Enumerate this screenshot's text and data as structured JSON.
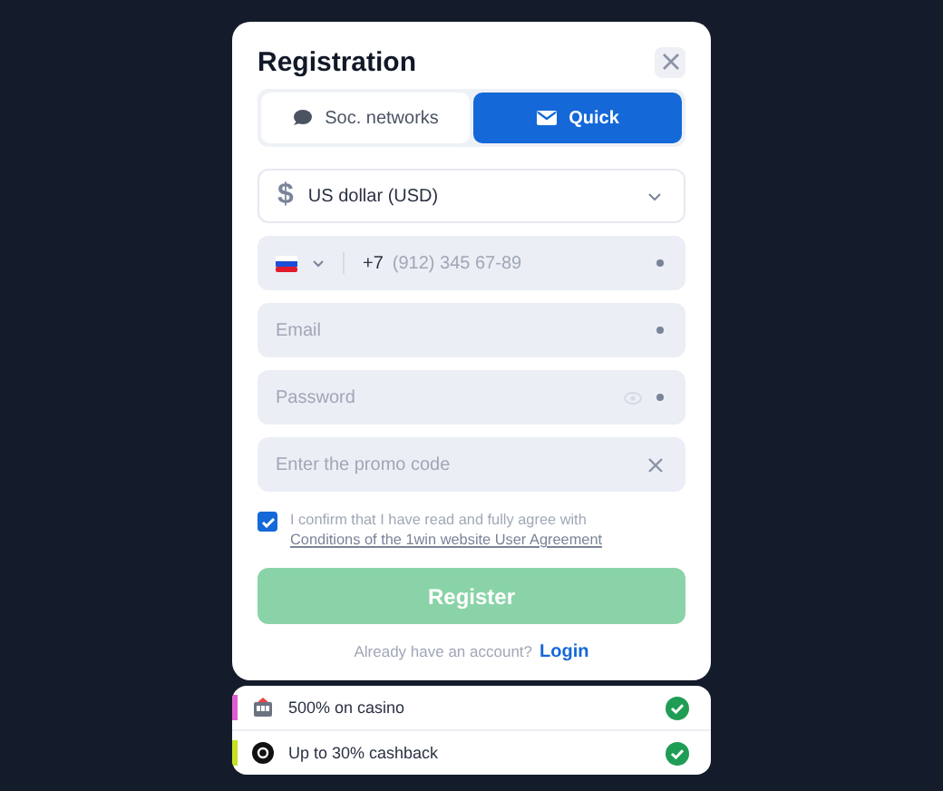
{
  "dialog": {
    "title": "Registration"
  },
  "tabs": [
    {
      "label": "Soc. networks",
      "selected": false
    },
    {
      "label": "Quick",
      "selected": true
    }
  ],
  "currency": {
    "symbol": "$",
    "value": "US dollar (USD)"
  },
  "phone": {
    "code": "+7",
    "placeholder": "(912) 345 67-89",
    "required": true
  },
  "email": {
    "placeholder": "Email",
    "required": true
  },
  "password": {
    "placeholder": "Password",
    "required": true
  },
  "promo": {
    "placeholder": "Enter the promo code"
  },
  "agreement": {
    "checked": true,
    "text": "I confirm that I have read and fully agree with",
    "link": "Conditions of the 1win website User Agreement"
  },
  "register": {
    "label": "Register",
    "disabled": true
  },
  "login_prompt": {
    "text": "Already have an account?",
    "link": "Login"
  },
  "bonuses": [
    {
      "kind": "casino",
      "text": "500% on casino",
      "color": "#e05cd0",
      "done": true
    },
    {
      "kind": "cashback",
      "text": "Up to 30% cashback",
      "color": "#c8e020",
      "done": true
    }
  ]
}
